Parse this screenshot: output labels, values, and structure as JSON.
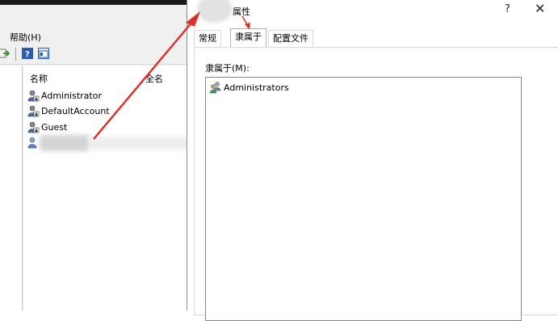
{
  "background_window": {
    "menu": {
      "help": "帮助(H)"
    },
    "columns": {
      "name": "名称",
      "full_name": "全名"
    },
    "users": [
      "Administrator",
      "DefaultAccount",
      "Guest"
    ]
  },
  "dialog": {
    "title_suffix": "属性",
    "help_button": "?",
    "close_button": "✕",
    "tabs": [
      "常规",
      "隶属于",
      "配置文件"
    ],
    "active_tab": "隶属于",
    "member_of_label": "隶属于(M):",
    "groups": [
      "Administrators"
    ]
  },
  "colors": {
    "annotation_arrow": "#e0302a"
  }
}
